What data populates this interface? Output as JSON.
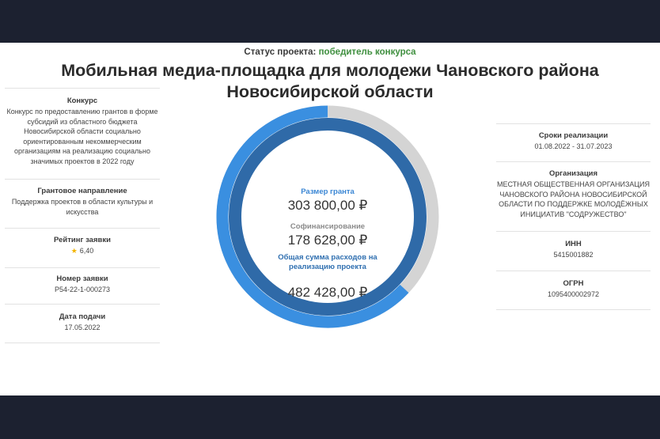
{
  "status": {
    "label": "Статус проекта:",
    "value": "победитель конкурса"
  },
  "title": "Мобильная медиа-площадка для молодежи Чановского района Новосибирской области",
  "left": [
    {
      "label": "Конкурс",
      "text": "Конкурс по предоставлению грантов в форме субсидий из областного бюджета Новосибирской области социально ориентированным некоммерческим организациям на реализацию социально значимых проектов в 2022 году"
    },
    {
      "label": "Грантовое направление",
      "text": "Поддержка проектов в области культуры и искусства"
    },
    {
      "label": "Рейтинг заявки",
      "text": "6,40"
    },
    {
      "label": "Номер заявки",
      "text": "P54-22-1-000273"
    },
    {
      "label": "Дата подачи",
      "text": "17.05.2022"
    }
  ],
  "right": [
    {
      "label": "Сроки реализации",
      "text": "01.08.2022 - 31.07.2023"
    },
    {
      "label": "Организация",
      "text": "МЕСТНАЯ ОБЩЕСТВЕННАЯ ОРГАНИЗАЦИЯ ЧАНОВСКОГО РАЙОНА НОВОСИБИРСКОЙ ОБЛАСТИ ПО ПОДДЕРЖКЕ МОЛОДЁЖНЫХ ИНИЦИАТИВ \"СОДРУЖЕСТВО\""
    },
    {
      "label": "ИНН",
      "text": "5415001882"
    },
    {
      "label": "ОГРН",
      "text": "1095400002972"
    }
  ],
  "chart": {
    "grant_label": "Размер гранта",
    "grant_value": "303 800,00 ₽",
    "cofin_label": "Софинансирование",
    "cofin_value": "178 628,00 ₽",
    "total_label": "Общая сумма расходов на реализацию проекта",
    "total_value": "482 428,00 ₽",
    "grant_share": 0.63,
    "colors": {
      "grant": "#3a8fe0",
      "cofin": "#d4d4d4",
      "total": "#2f6aa8"
    }
  }
}
